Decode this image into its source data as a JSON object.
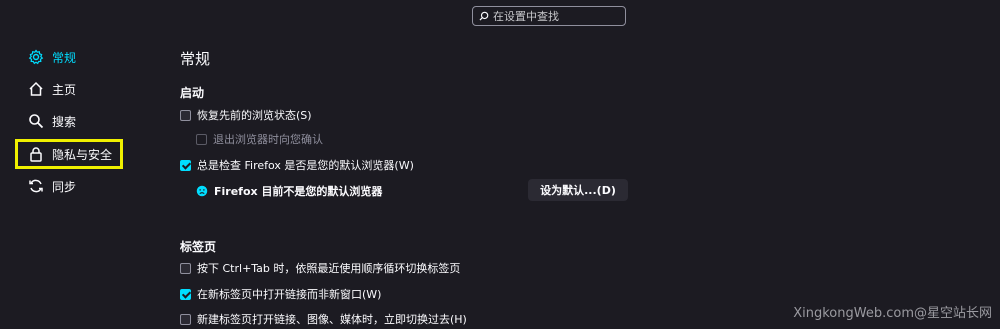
{
  "search": {
    "placeholder": "在设置中查找"
  },
  "sidebar": {
    "items": [
      {
        "label": "常规",
        "icon": "gear-icon",
        "active": true
      },
      {
        "label": "主页",
        "icon": "home-icon",
        "active": false
      },
      {
        "label": "搜索",
        "icon": "search-icon",
        "active": false
      },
      {
        "label": "隐私与安全",
        "icon": "lock-icon",
        "active": false
      },
      {
        "label": "同步",
        "icon": "sync-icon",
        "active": false
      }
    ],
    "highlight_color": "#f0f000"
  },
  "main": {
    "title": "常规",
    "startup": {
      "heading": "启动",
      "restore_session": {
        "label": "恢复先前的浏览状态(S)",
        "checked": false
      },
      "warn_on_quit": {
        "label": "退出浏览器时向您确认",
        "checked": false,
        "disabled": true
      },
      "check_default": {
        "label": "总是检查 Firefox 是否是您的默认浏览器(W)",
        "checked": true
      },
      "status_text": "Firefox 目前不是您的默认浏览器",
      "set_default_button": "设为默认...(D)"
    },
    "tabs": {
      "heading": "标签页",
      "ctrl_tab": {
        "label": "按下 Ctrl+Tab 时，依照最近使用顺序循环切换标签页",
        "checked": false
      },
      "open_links_in_tabs": {
        "label": "在新标签页中打开链接而非新窗口(W)",
        "checked": true
      },
      "switch_to_new": {
        "label": "新建标签页打开链接、图像、媒体时，立即切换过去(H)",
        "checked": false
      }
    }
  },
  "watermark": "XingkongWeb.com@星空站长网",
  "colors": {
    "accent": "#00ddff",
    "background": "#1c1b22",
    "text": "#fbfbfe"
  }
}
